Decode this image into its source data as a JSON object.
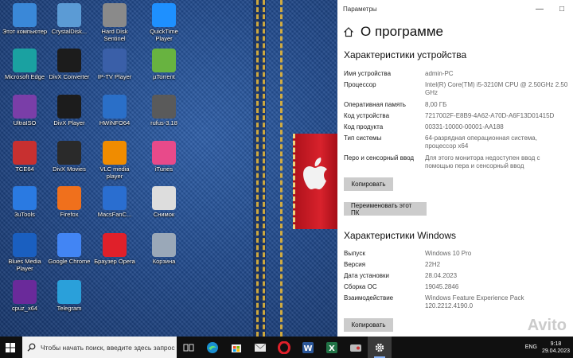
{
  "desktop": {
    "icons": [
      {
        "label": "Этот компьютер",
        "icon": "computer-icon",
        "color": "#3a88d8"
      },
      {
        "label": "CrystalDisk...",
        "icon": "crystaldisk-icon",
        "color": "#5b9bd5"
      },
      {
        "label": "Hard Disk Sentinel",
        "icon": "hdd-sentinel-icon",
        "color": "#8a8a8a"
      },
      {
        "label": "QuickTime Player",
        "icon": "quicktime-icon",
        "color": "#1e90ff"
      },
      {
        "label": "Microsoft Edge",
        "icon": "edge-icon",
        "color": "#1aa1a1"
      },
      {
        "label": "DivX Converter",
        "icon": "divx-converter-icon",
        "color": "#1c1c1c"
      },
      {
        "label": "IP-TV Player",
        "icon": "iptv-icon",
        "color": "#3a5fa8"
      },
      {
        "label": "µTorrent",
        "icon": "utorrent-icon",
        "color": "#68b340"
      },
      {
        "label": "UltraISO",
        "icon": "ultraiso-icon",
        "color": "#7a3ea8"
      },
      {
        "label": "DivX Player",
        "icon": "divx-player-icon",
        "color": "#1c1c1c"
      },
      {
        "label": "HWiNFO64",
        "icon": "hwinfo-icon",
        "color": "#2a6fc8"
      },
      {
        "label": "rufus-3.18",
        "icon": "rufus-icon",
        "color": "#5a5a5a"
      },
      {
        "label": "TCE64",
        "icon": "tce-icon",
        "color": "#c83030"
      },
      {
        "label": "DivX Movies",
        "icon": "divx-movies-icon",
        "color": "#2a2a2a"
      },
      {
        "label": "VLC media player",
        "icon": "vlc-icon",
        "color": "#f08c00"
      },
      {
        "label": "iTunes",
        "icon": "itunes-icon",
        "color": "#e84a8a"
      },
      {
        "label": "3uTools",
        "icon": "3utools-icon",
        "color": "#2a7ae2"
      },
      {
        "label": "Firefox",
        "icon": "firefox-icon",
        "color": "#f0701c"
      },
      {
        "label": "MacsFanC...",
        "icon": "macsfan-icon",
        "color": "#2a6ed0"
      },
      {
        "label": "Снимок",
        "icon": "snapshot-icon",
        "color": "#dddddd"
      },
      {
        "label": "Blues Media Player",
        "icon": "blues-player-icon",
        "color": "#1a5fc0"
      },
      {
        "label": "Google Chrome",
        "icon": "chrome-icon",
        "color": "#4285f4"
      },
      {
        "label": "Браузер Opera",
        "icon": "opera-icon",
        "color": "#e0202a"
      },
      {
        "label": "Корзина",
        "icon": "recycle-bin-icon",
        "color": "#9aa8b8"
      },
      {
        "label": "cpuz_x64",
        "icon": "cpuz-icon",
        "color": "#6a2a9a"
      },
      {
        "label": "Telegram",
        "icon": "telegram-icon",
        "color": "#2aa0da"
      }
    ]
  },
  "settings": {
    "window_title": "Параметры",
    "page_title": "О программе",
    "device_section": {
      "title": "Характеристики устройства",
      "rows": [
        {
          "key": "Имя устройства",
          "value": "admin-PC"
        },
        {
          "key": "Процессор",
          "value": "Intel(R) Core(TM) i5-3210M CPU @ 2.50GHz   2.50 GHz"
        },
        {
          "key": "Оперативная память",
          "value": "8,00 ГБ"
        },
        {
          "key": "Код устройства",
          "value": "7217002F-E8B9-4A62-A70D-A6F13D01415D"
        },
        {
          "key": "Код продукта",
          "value": "00331-10000-00001-AA188"
        },
        {
          "key": "Тип системы",
          "value": "64-разрядная операционная система, процессор x64"
        },
        {
          "key": "Перо и сенсорный ввод",
          "value": "Для этого монитора недоступен ввод с помощью пера и сенсорный ввод"
        }
      ],
      "copy_button": "Копировать",
      "rename_button": "Переименовать этот ПК"
    },
    "windows_section": {
      "title": "Характеристики Windows",
      "rows": [
        {
          "key": "Выпуск",
          "value": "Windows 10 Pro"
        },
        {
          "key": "Версия",
          "value": "22H2"
        },
        {
          "key": "Дата установки",
          "value": "28.04.2023"
        },
        {
          "key": "Сборка ОС",
          "value": "19045.2846"
        },
        {
          "key": "Взаимодействие",
          "value": "Windows Feature Experience Pack 120.2212.4190.0"
        }
      ],
      "copy_button": "Копировать"
    }
  },
  "watermark": "Avito",
  "taskbar": {
    "search_placeholder": "Чтобы начать поиск, введите здесь запрос",
    "tray": {
      "language": "ENG",
      "time": "9:18",
      "date": "29.04.2023"
    }
  }
}
